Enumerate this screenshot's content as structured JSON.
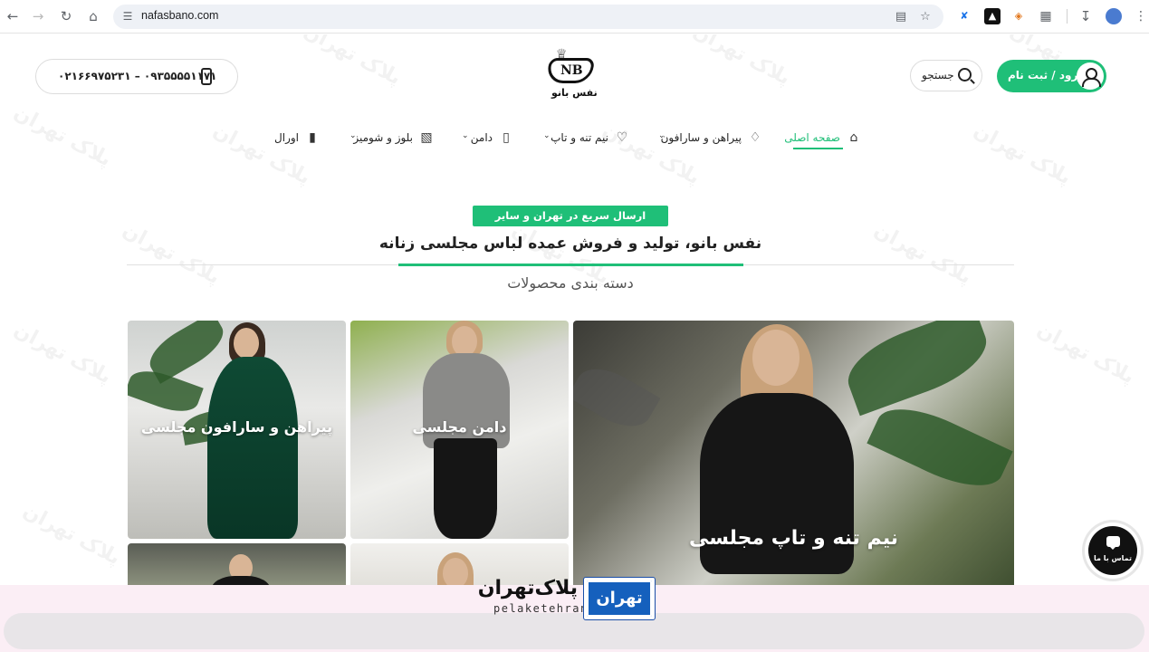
{
  "browser": {
    "url": "nafasbano.com"
  },
  "header": {
    "phone": "۰۲۱۶۶۹۷۵۲۳۱ – ۰۹۳۵۵۵۵۱۱۷۱",
    "logo_text": "نفس بانو",
    "logo_mark": "NB",
    "search_label": "جستجو",
    "login_label": "ورود / ثبت نام"
  },
  "menu": [
    {
      "label": "صفحه اصلی",
      "icon": "home-icon",
      "active": true
    },
    {
      "label": "پیراهن و سارافون",
      "icon": "dress-icon"
    },
    {
      "label": "نیم تنه و تاپ",
      "icon": "top-icon"
    },
    {
      "label": "دامن",
      "icon": "skirt-icon"
    },
    {
      "label": "بلوز و شومیز",
      "icon": "shirt-icon"
    },
    {
      "label": "اورال",
      "icon": "overall-icon"
    }
  ],
  "hero": {
    "badge": "ارسال سریع در تهران و سایر شهرستان‌ها",
    "headline": "نفس بانو، تولید و فروش عمده لباس مجلسی زنانه",
    "subhead": "دسته بندی محصولات"
  },
  "categories": [
    {
      "label": "نیم تنه و تاپ مجلسی"
    },
    {
      "label": "دامن مجلسی"
    },
    {
      "label": "پیراهن و سارافون مجلسی"
    }
  ],
  "chat": {
    "label": "تماس با ما"
  },
  "overlay": {
    "brand_fa": "پلاک‌تهران",
    "brand_en": "pelaketehran",
    "plate_text": "تهران"
  },
  "watermark_text": "پلاک تهران",
  "colors": {
    "accent": "#1fbf78",
    "plate_blue": "#1560bd"
  }
}
